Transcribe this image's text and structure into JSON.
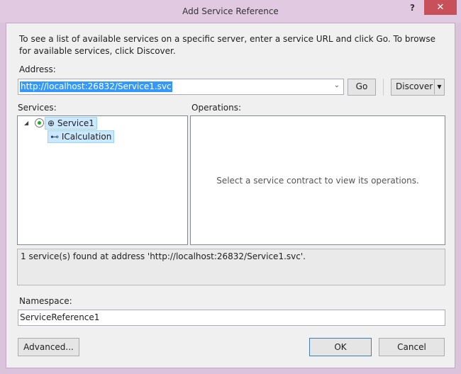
{
  "window": {
    "title": "Add Service Reference",
    "help": "?",
    "close": "✕"
  },
  "description": "To see a list of available services on a specific server, enter a service URL and click Go. To browse for available services, click Discover.",
  "address": {
    "label": "Address:",
    "value": "http://localhost:26832/Service1.svc"
  },
  "buttons": {
    "go": "Go",
    "discover": "Discover",
    "advanced": "Advanced...",
    "ok": "OK",
    "cancel": "Cancel"
  },
  "services": {
    "label": "Services:",
    "items": [
      {
        "label": "Service1"
      },
      {
        "label": "ICalculation"
      }
    ]
  },
  "operations": {
    "label": "Operations:",
    "placeholder": "Select a service contract to view its operations."
  },
  "status": "1 service(s) found at address 'http://localhost:26832/Service1.svc'.",
  "namespace": {
    "label": "Namespace:",
    "value": "ServiceReference1"
  }
}
